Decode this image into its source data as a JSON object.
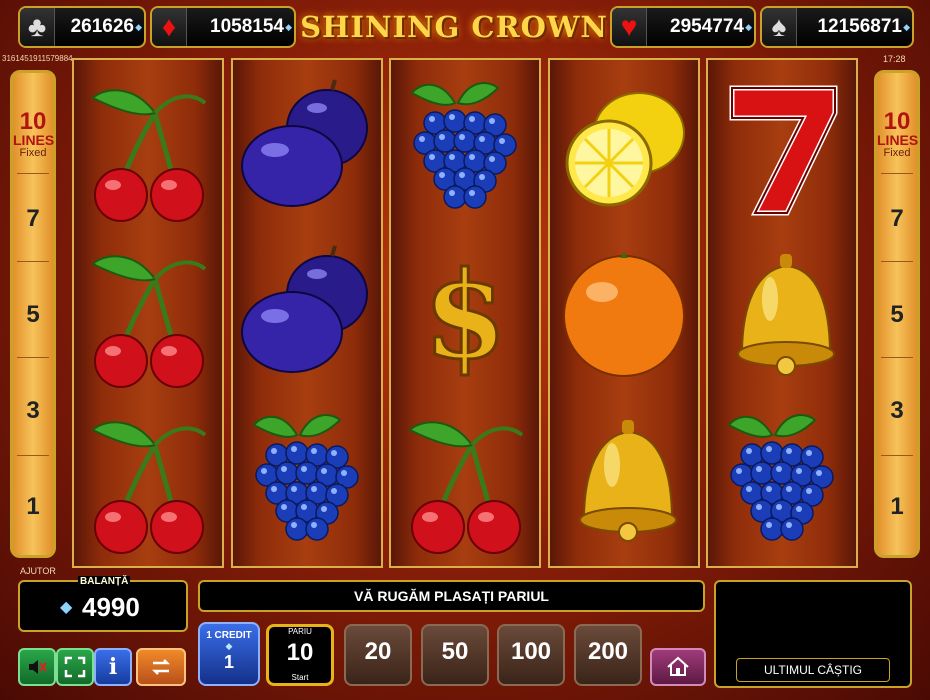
{
  "jackpots": [
    {
      "suit": "♣",
      "value": "261626"
    },
    {
      "suit": "♦",
      "value": "1058154"
    },
    {
      "suit": "♥",
      "value": "2954774"
    },
    {
      "suit": "♠",
      "value": "12156871"
    }
  ],
  "title": "SHINING CROWN",
  "game_id": "3161451911579884",
  "clock": "17:28",
  "lines_panel": {
    "count": "10",
    "label": "LINES",
    "mode": "Fixed",
    "numbers": [
      "7",
      "5",
      "3",
      "1"
    ]
  },
  "reels": [
    [
      "cherry",
      "cherry",
      "cherry"
    ],
    [
      "plum",
      "plum",
      "grapes"
    ],
    [
      "grapes",
      "dollar",
      "cherry"
    ],
    [
      "lemon",
      "orange",
      "bell"
    ],
    [
      "seven",
      "bell",
      "grapes"
    ]
  ],
  "help_label": "AJUTOR",
  "balance": {
    "label": "BALANȚĂ",
    "value": "4990"
  },
  "message": "VĂ RUGĂM PLASAȚI PARIUL",
  "credit": {
    "label": "1 CREDIT",
    "value": "1"
  },
  "bets": [
    {
      "top": "PARIU",
      "value": "10",
      "bottom": "Start",
      "selected": true
    },
    {
      "top": "",
      "value": "20",
      "bottom": "",
      "selected": false
    },
    {
      "top": "",
      "value": "50",
      "bottom": "",
      "selected": false
    },
    {
      "top": "",
      "value": "100",
      "bottom": "",
      "selected": false
    },
    {
      "top": "",
      "value": "200",
      "bottom": "",
      "selected": false
    }
  ],
  "last_win_label": "ULTIMUL CÂȘTIG",
  "icons": [
    "mute-icon",
    "fullscreen-icon",
    "info-icon",
    "autoplay-icon",
    "home-icon"
  ],
  "colors": {
    "frame_gold": "#c9a227",
    "reel_red": "#a83e10"
  }
}
